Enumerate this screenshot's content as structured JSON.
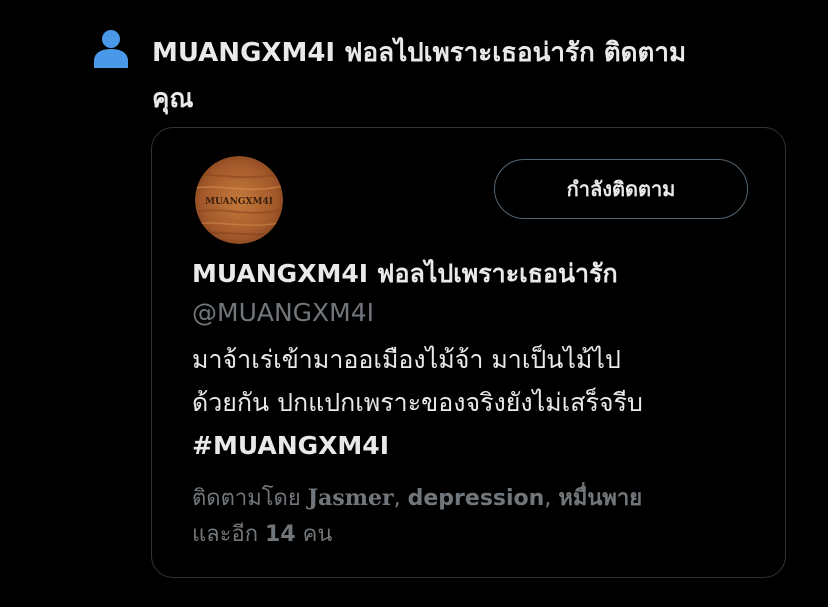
{
  "notification": {
    "icon": "person-icon",
    "accent_color": "#4a99e9",
    "text_line1": "MUANGXM4I ฟอลไปเพราะเธอน่ารัก ติดตาม",
    "text_line2": "คุณ"
  },
  "profile_card": {
    "avatar": {
      "icon": "wood-logo-avatar",
      "logo_text": "MUANGXM4I"
    },
    "follow_button_label": "กำลังติดตาม",
    "display_name": "MUANGXM4I ฟอลไปเพราะเธอน่ารัก",
    "handle": "@MUANGXM4I",
    "bio": {
      "line1": "มาจ้าเร่เข้ามาออเมืองไม้จ้า มาเป็นไม้ไป",
      "line2": "ด้วยกัน ปกแปกเพราะของจริงยังไม่เสร็จรีบ",
      "hashtag": "#MUANGXM4I"
    },
    "followed_by": {
      "prefix": "ติดตามโดย",
      "name1": "Jasmer",
      "separator1": ",",
      "name2": "depression",
      "separator2": ",",
      "name3": "หมื่นพาย",
      "line2_prefix": "และอีก",
      "count": "14",
      "suffix": "คน"
    }
  }
}
